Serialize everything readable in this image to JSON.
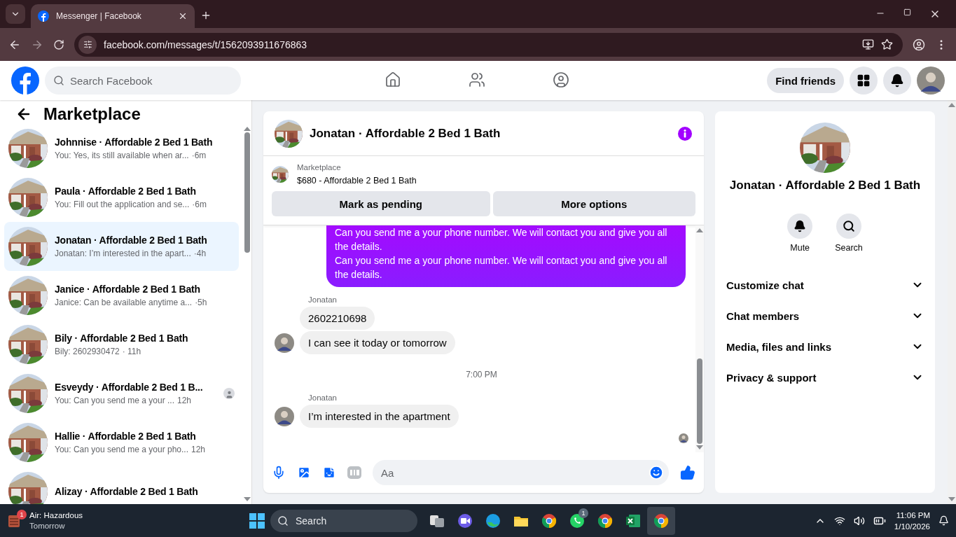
{
  "browser": {
    "tab_title": "Messenger | Facebook",
    "url": "facebook.com/messages/t/1562093911676863"
  },
  "topbar": {
    "search_placeholder": "Search Facebook",
    "find_friends": "Find friends",
    "nav": [
      {
        "kind": "home",
        "selected": false
      },
      {
        "kind": "friends",
        "selected": false
      },
      {
        "kind": "groups",
        "selected": false
      }
    ]
  },
  "sidebar": {
    "title": "Marketplace",
    "conversations": [
      {
        "name": "Johnnise · Affordable 2 Bed 1 Bath",
        "preview": "You: Yes, its still available when ar...",
        "time": "·6m",
        "selected": false,
        "seen": false
      },
      {
        "name": "Paula · Affordable 2 Bed 1 Bath",
        "preview": "You: Fill out the application and se...",
        "time": "·6m",
        "selected": false,
        "seen": false
      },
      {
        "name": "Jonatan · Affordable 2 Bed 1 Bath",
        "preview": "Jonatan: I’m interested in the apart...",
        "time": "·4h",
        "selected": true,
        "seen": false
      },
      {
        "name": "Janice · Affordable 2 Bed 1 Bath",
        "preview": "Janice: Can be available anytime a...",
        "time": "·5h",
        "selected": false,
        "seen": false
      },
      {
        "name": "Bily · Affordable 2 Bed 1 Bath",
        "preview": "Bily: 2602930472",
        "time": "· 11h",
        "selected": false,
        "seen": false
      },
      {
        "name": "Esveydy · Affordable 2 Bed 1 B...",
        "preview": "You: Can you send me a your ...",
        "time": "12h",
        "selected": false,
        "seen": true
      },
      {
        "name": "Hallie · Affordable 2 Bed 1 Bath",
        "preview": "You: Can you send me a your pho...",
        "time": "12h",
        "selected": false,
        "seen": false
      },
      {
        "name": "Alizay · Affordable 2 Bed 1 Bath",
        "selected": false,
        "seen": false
      }
    ]
  },
  "chat": {
    "title": "Jonatan · Affordable 2 Bed 1 Bath",
    "listing": {
      "label": "Marketplace",
      "title": "$680 - Affordable 2 Bed 1 Bath"
    },
    "buttons": [
      "Mark as pending",
      "More options"
    ],
    "messages": [
      {
        "kind": "outgoing",
        "lines": [
          "Can you send me a your phone number. We will contact you and give you all the details.",
          "Can you send me a your phone number. We will contact you and give you all the details."
        ]
      },
      {
        "kind": "sender",
        "text": "Jonatan"
      },
      {
        "kind": "incoming",
        "text": "2602210698",
        "avatar": false
      },
      {
        "kind": "incoming",
        "text": "I can see it today or tomorrow",
        "avatar": true
      },
      {
        "kind": "time",
        "text": "7:00 PM"
      },
      {
        "kind": "sender",
        "text": "Jonatan"
      },
      {
        "kind": "incoming",
        "text": "I’m interested in the apartment",
        "avatar": true
      },
      {
        "kind": "seen"
      }
    ],
    "composer": {
      "placeholder": "Aa"
    }
  },
  "info": {
    "title": "Jonatan · Affordable 2 Bed 1 Bath",
    "actions": [
      {
        "kind": "mute",
        "label": "Mute"
      },
      {
        "kind": "search",
        "label": "Search"
      }
    ],
    "sections": [
      {
        "label": "Customize chat",
        "expanded": false
      },
      {
        "label": "Chat members",
        "expanded": false
      },
      {
        "label": "Media, files and links",
        "expanded": false
      },
      {
        "label": "Privacy & support",
        "expanded": false
      }
    ]
  },
  "taskbar": {
    "weather": {
      "badge": "1",
      "title": "Air: Hazardous",
      "subtitle": "Tomorrow"
    },
    "search": "Search",
    "apps": [
      {
        "kind": "widgets"
      },
      {
        "kind": "windows"
      },
      {
        "kind": "video"
      },
      {
        "kind": "edge"
      },
      {
        "kind": "folder"
      },
      {
        "kind": "chrome"
      },
      {
        "kind": "whatsapp",
        "badge": "1"
      },
      {
        "kind": "chrome-profile"
      },
      {
        "kind": "excel"
      },
      {
        "kind": "chrome-profile",
        "selected": true
      }
    ],
    "time": "11:06 PM",
    "date": "1/10/2026"
  }
}
